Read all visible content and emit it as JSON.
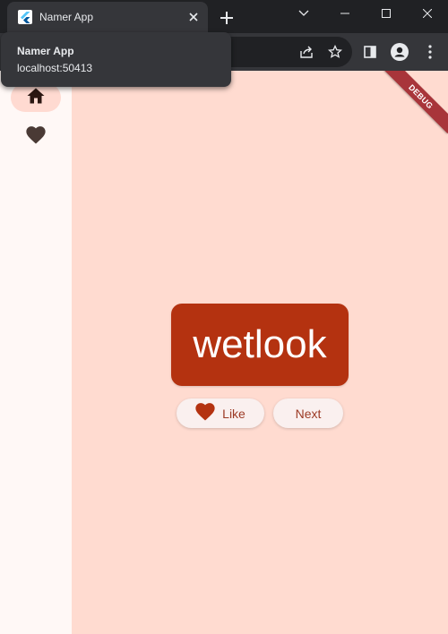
{
  "tab": {
    "title": "Namer App",
    "close_icon": "close-icon",
    "favicon": "flutter-icon"
  },
  "hovercard": {
    "title": "Namer App",
    "url": "localhost:50413"
  },
  "toolbar": {
    "share_icon": "share-icon",
    "bookmark_icon": "star-icon",
    "sidepanel_icon": "side-panel-icon",
    "profile_icon": "profile-icon",
    "menu_icon": "more-vert-icon"
  },
  "window": {
    "minimize": "minimize-icon",
    "maximize": "maximize-icon",
    "close": "close-icon"
  },
  "nav_rail": {
    "items": [
      {
        "icon": "home-icon",
        "selected": true
      },
      {
        "icon": "favorite-icon",
        "selected": false
      }
    ]
  },
  "debug_banner": "DEBUG",
  "main": {
    "word": "wetlook",
    "like_label": "Like",
    "next_label": "Next"
  },
  "colors": {
    "background": "#ffdbd0",
    "rail": "#fff8f6",
    "card": "#b43210",
    "button_text": "#9c3a25"
  }
}
